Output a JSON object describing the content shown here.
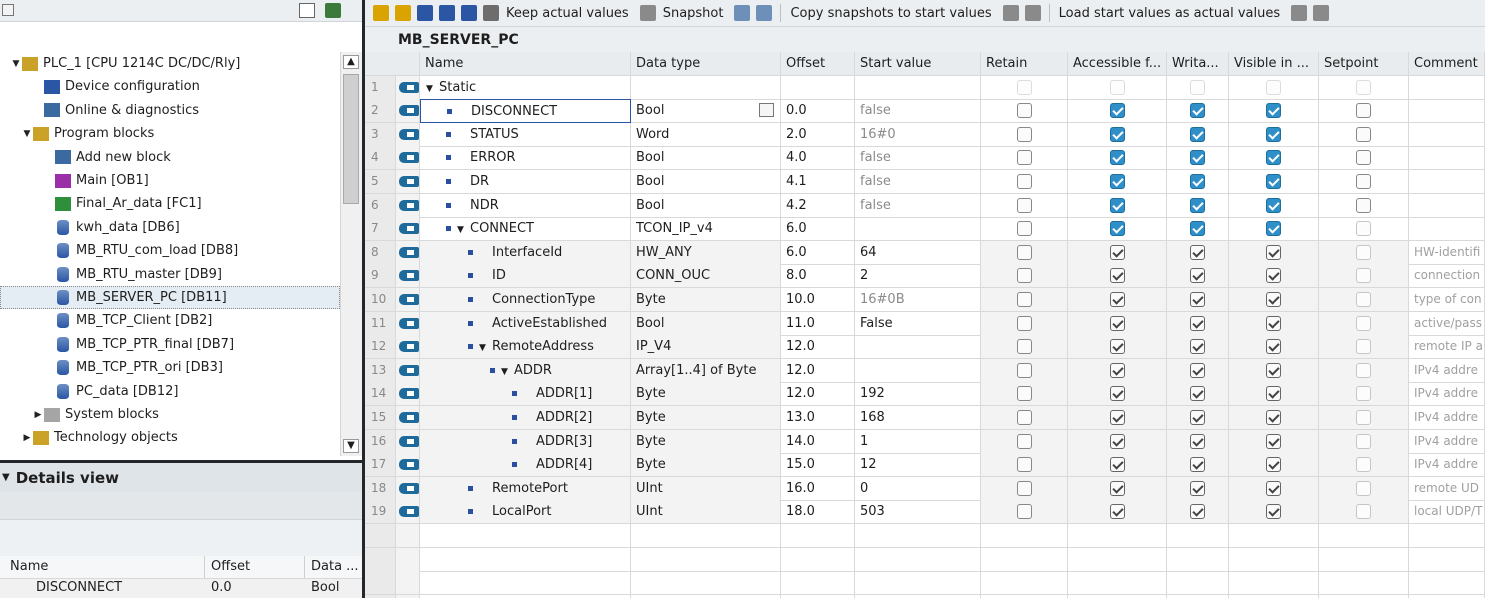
{
  "tree": {
    "items": [
      {
        "label": "PLC_1 [CPU 1214C DC/DC/Rly]",
        "icon": "plc-folder-icon",
        "indent": 0,
        "expander": "▼",
        "selected": false
      },
      {
        "label": "Device configuration",
        "icon": "device-config-icon",
        "indent": 2,
        "expander": "",
        "selected": false
      },
      {
        "label": "Online & diagnostics",
        "icon": "online-diag-icon",
        "indent": 2,
        "expander": "",
        "selected": false
      },
      {
        "label": "Program blocks",
        "icon": "program-blocks-folder-icon",
        "indent": 1,
        "expander": "▼",
        "selected": false
      },
      {
        "label": "Add new block",
        "icon": "add-block-icon",
        "indent": 3,
        "expander": "",
        "selected": false
      },
      {
        "label": "Main [OB1]",
        "icon": "ob-icon",
        "indent": 3,
        "expander": "",
        "selected": false
      },
      {
        "label": "Final_Ar_data [FC1]",
        "icon": "fc-icon",
        "indent": 3,
        "expander": "",
        "selected": false
      },
      {
        "label": "kwh_data [DB6]",
        "icon": "db-icon",
        "indent": 3,
        "expander": "",
        "selected": false
      },
      {
        "label": "MB_RTU_com_load [DB8]",
        "icon": "db-icon",
        "indent": 3,
        "expander": "",
        "selected": false
      },
      {
        "label": "MB_RTU_master [DB9]",
        "icon": "db-icon",
        "indent": 3,
        "expander": "",
        "selected": false
      },
      {
        "label": "MB_SERVER_PC [DB11]",
        "icon": "db-icon",
        "indent": 3,
        "expander": "",
        "selected": true
      },
      {
        "label": "MB_TCP_Client [DB2]",
        "icon": "db-icon",
        "indent": 3,
        "expander": "",
        "selected": false
      },
      {
        "label": "MB_TCP_PTR_final [DB7]",
        "icon": "db-icon",
        "indent": 3,
        "expander": "",
        "selected": false
      },
      {
        "label": "MB_TCP_PTR_ori [DB3]",
        "icon": "db-icon",
        "indent": 3,
        "expander": "",
        "selected": false
      },
      {
        "label": "PC_data [DB12]",
        "icon": "db-icon",
        "indent": 3,
        "expander": "",
        "selected": false
      },
      {
        "label": "System blocks",
        "icon": "system-blocks-folder-icon",
        "indent": 2,
        "expander": "▶",
        "selected": false
      },
      {
        "label": "Technology objects",
        "icon": "technology-objects-icon",
        "indent": 1,
        "expander": "▶",
        "selected": false
      }
    ]
  },
  "details": {
    "title": "Details view",
    "columns": [
      "Name",
      "Offset",
      "Data ..."
    ],
    "row": {
      "name": "DISCONNECT",
      "offset": "0.0",
      "type": "Bool"
    }
  },
  "toolbar": {
    "keep_actual": "Keep actual values",
    "snapshot": "Snapshot",
    "copy_snapshots": "Copy snapshots to start values",
    "load_start": "Load start values as actual values"
  },
  "db_title": "MB_SERVER_PC",
  "grid": {
    "columns": [
      "Name",
      "Data type",
      "Offset",
      "Start value",
      "Retain",
      "Accessible f...",
      "Writa...",
      "Visible in ...",
      "Setpoint",
      "Comment"
    ],
    "rows": [
      {
        "num": "1",
        "level": 0,
        "exp": "▼",
        "bullet": false,
        "name": "Static",
        "type": "",
        "offset": "",
        "start": "",
        "start_grey": false,
        "retain": "blank",
        "acc": "blank",
        "wr": "blank",
        "vis": "blank",
        "set": "blank",
        "comment": ""
      },
      {
        "num": "2",
        "level": 1,
        "exp": "",
        "bullet": true,
        "name": "DISCONNECT",
        "type": "Bool",
        "offset": "0.0",
        "start": "false",
        "start_grey": true,
        "retain": "off",
        "acc": "on",
        "wr": "on",
        "vis": "on",
        "set": "off",
        "comment": "",
        "edit": true
      },
      {
        "num": "3",
        "level": 1,
        "exp": "",
        "bullet": true,
        "name": "STATUS",
        "type": "Word",
        "offset": "2.0",
        "start": "16#0",
        "start_grey": true,
        "retain": "off",
        "acc": "on",
        "wr": "on",
        "vis": "on",
        "set": "off",
        "comment": ""
      },
      {
        "num": "4",
        "level": 1,
        "exp": "",
        "bullet": true,
        "name": "ERROR",
        "type": "Bool",
        "offset": "4.0",
        "start": "false",
        "start_grey": true,
        "retain": "off",
        "acc": "on",
        "wr": "on",
        "vis": "on",
        "set": "off",
        "comment": ""
      },
      {
        "num": "5",
        "level": 1,
        "exp": "",
        "bullet": true,
        "name": "DR",
        "type": "Bool",
        "offset": "4.1",
        "start": "false",
        "start_grey": true,
        "retain": "off",
        "acc": "on",
        "wr": "on",
        "vis": "on",
        "set": "off",
        "comment": ""
      },
      {
        "num": "6",
        "level": 1,
        "exp": "",
        "bullet": true,
        "name": "NDR",
        "type": "Bool",
        "offset": "4.2",
        "start": "false",
        "start_grey": true,
        "retain": "off",
        "acc": "on",
        "wr": "on",
        "vis": "on",
        "set": "off",
        "comment": ""
      },
      {
        "num": "7",
        "level": 1,
        "exp": "▼",
        "bullet": true,
        "name": "CONNECT",
        "type": "TCON_IP_v4",
        "offset": "6.0",
        "start": "",
        "start_grey": false,
        "retain": "off",
        "acc": "on",
        "wr": "on",
        "vis": "on",
        "set": "faded",
        "comment": ""
      },
      {
        "num": "8",
        "level": 2,
        "exp": "",
        "bullet": true,
        "name": "InterfaceId",
        "type": "HW_ANY",
        "offset": "6.0",
        "start": "64",
        "start_grey": false,
        "retain": "off",
        "acc": "ron",
        "wr": "ron",
        "vis": "ron",
        "set": "faded",
        "comment": "HW-identifi"
      },
      {
        "num": "9",
        "level": 2,
        "exp": "",
        "bullet": true,
        "name": "ID",
        "type": "CONN_OUC",
        "offset": "8.0",
        "start": "2",
        "start_grey": false,
        "retain": "off",
        "acc": "ron",
        "wr": "ron",
        "vis": "ron",
        "set": "faded",
        "comment": "connection"
      },
      {
        "num": "10",
        "level": 2,
        "exp": "",
        "bullet": true,
        "name": "ConnectionType",
        "type": "Byte",
        "offset": "10.0",
        "start": "16#0B",
        "start_grey": true,
        "retain": "off",
        "acc": "ron",
        "wr": "ron",
        "vis": "ron",
        "set": "faded",
        "comment": "type of con"
      },
      {
        "num": "11",
        "level": 2,
        "exp": "",
        "bullet": true,
        "name": "ActiveEstablished",
        "type": "Bool",
        "offset": "11.0",
        "start": "False",
        "start_grey": false,
        "retain": "off",
        "acc": "ron",
        "wr": "ron",
        "vis": "ron",
        "set": "faded",
        "comment": "active/pass"
      },
      {
        "num": "12",
        "level": 2,
        "exp": "▼",
        "bullet": true,
        "name": "RemoteAddress",
        "type": "IP_V4",
        "offset": "12.0",
        "start": "",
        "start_grey": false,
        "retain": "off",
        "acc": "ron",
        "wr": "ron",
        "vis": "ron",
        "set": "faded",
        "comment": "remote IP a"
      },
      {
        "num": "13",
        "level": 3,
        "exp": "▼",
        "bullet": true,
        "name": "ADDR",
        "type": "Array[1..4] of Byte",
        "offset": "12.0",
        "start": "",
        "start_grey": false,
        "retain": "off",
        "acc": "ron",
        "wr": "ron",
        "vis": "ron",
        "set": "faded",
        "comment": "IPv4 addre"
      },
      {
        "num": "14",
        "level": 4,
        "exp": "",
        "bullet": true,
        "name": "ADDR[1]",
        "type": "Byte",
        "offset": "12.0",
        "start": "192",
        "start_grey": false,
        "retain": "off",
        "acc": "ron",
        "wr": "ron",
        "vis": "ron",
        "set": "faded",
        "comment": "IPv4 addre"
      },
      {
        "num": "15",
        "level": 4,
        "exp": "",
        "bullet": true,
        "name": "ADDR[2]",
        "type": "Byte",
        "offset": "13.0",
        "start": "168",
        "start_grey": false,
        "retain": "off",
        "acc": "ron",
        "wr": "ron",
        "vis": "ron",
        "set": "faded",
        "comment": "IPv4 addre"
      },
      {
        "num": "16",
        "level": 4,
        "exp": "",
        "bullet": true,
        "name": "ADDR[3]",
        "type": "Byte",
        "offset": "14.0",
        "start": "1",
        "start_grey": false,
        "retain": "off",
        "acc": "ron",
        "wr": "ron",
        "vis": "ron",
        "set": "faded",
        "comment": "IPv4 addre"
      },
      {
        "num": "17",
        "level": 4,
        "exp": "",
        "bullet": true,
        "name": "ADDR[4]",
        "type": "Byte",
        "offset": "15.0",
        "start": "12",
        "start_grey": false,
        "retain": "off",
        "acc": "ron",
        "wr": "ron",
        "vis": "ron",
        "set": "faded",
        "comment": "IPv4 addre"
      },
      {
        "num": "18",
        "level": 2,
        "exp": "",
        "bullet": true,
        "name": "RemotePort",
        "type": "UInt",
        "offset": "16.0",
        "start": "0",
        "start_grey": false,
        "retain": "off",
        "acc": "ron",
        "wr": "ron",
        "vis": "ron",
        "set": "faded",
        "comment": "remote UD"
      },
      {
        "num": "19",
        "level": 2,
        "exp": "",
        "bullet": true,
        "name": "LocalPort",
        "type": "UInt",
        "offset": "18.0",
        "start": "503",
        "start_grey": false,
        "retain": "off",
        "acc": "ron",
        "wr": "ron",
        "vis": "ron",
        "set": "faded",
        "comment": "local UDP/T"
      }
    ]
  },
  "colors": {
    "accent": "#2e8fc9",
    "divider": "#23262b",
    "db_icon": "#2a56a4"
  }
}
